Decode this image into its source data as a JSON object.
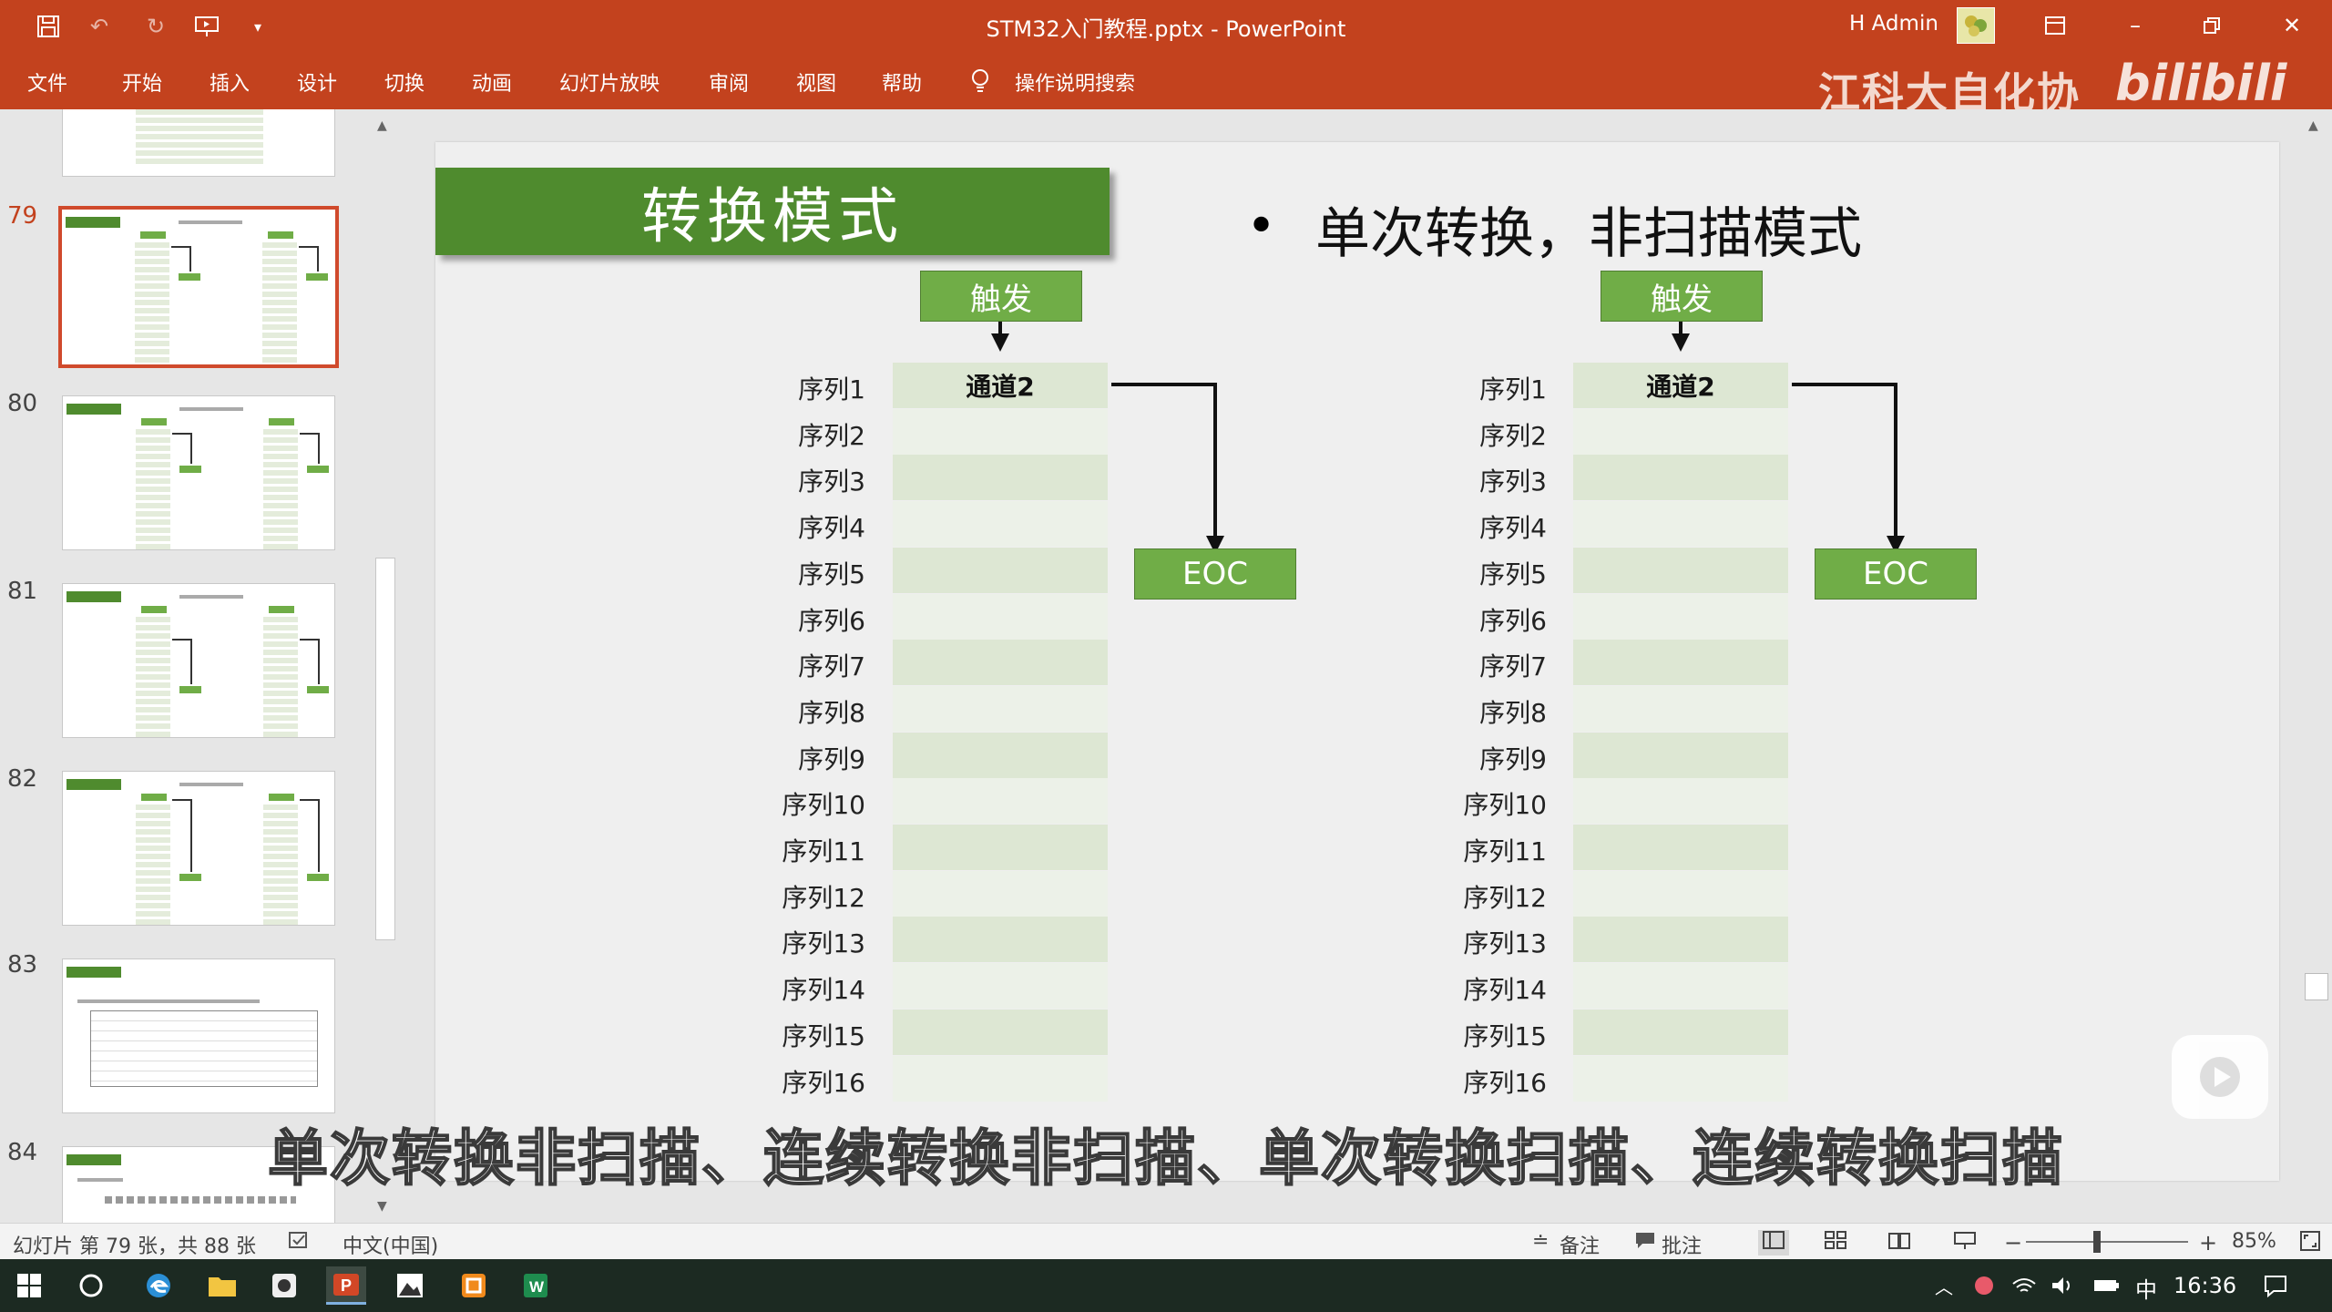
{
  "window": {
    "title": "STM32入门教程.pptx  -  PowerPoint",
    "user": "H Admin"
  },
  "ribbon": {
    "tabs": [
      "文件",
      "开始",
      "插入",
      "设计",
      "切换",
      "动画",
      "幻灯片放映",
      "审阅",
      "视图",
      "帮助"
    ],
    "tell_me": "操作说明搜索"
  },
  "watermark": {
    "brand": "江科大自化协",
    "logo": "bilibili"
  },
  "thumbnails": {
    "items": [
      {
        "num": "79",
        "active": true
      },
      {
        "num": "80",
        "active": false
      },
      {
        "num": "81",
        "active": false
      },
      {
        "num": "82",
        "active": false
      },
      {
        "num": "83",
        "active": false
      },
      {
        "num": "84",
        "active": false
      }
    ]
  },
  "slide": {
    "title": "转换模式",
    "bullet": "单次转换，非扫描模式",
    "trigger_label": "触发",
    "eoc_label": "EOC",
    "sequence_labels": [
      "序列1",
      "序列2",
      "序列3",
      "序列4",
      "序列5",
      "序列6",
      "序列7",
      "序列8",
      "序列9",
      "序列10",
      "序列11",
      "序列12",
      "序列13",
      "序列14",
      "序列15",
      "序列16"
    ],
    "channel_label": "通道2"
  },
  "subtitle": "单次转换非扫描、连续转换非扫描、单次转换扫描、连续转换扫描",
  "statusbar": {
    "slide_info": "幻灯片 第 79 张，共 88 张",
    "language": "中文(中国)",
    "notes": "备注",
    "comments": "批注",
    "zoom": "85%"
  },
  "taskbar": {
    "time": "16:36",
    "ime": "中"
  },
  "colors": {
    "accent": "#c3421e",
    "title_green": "#4f8b2e",
    "box_green": "#70ad47"
  }
}
